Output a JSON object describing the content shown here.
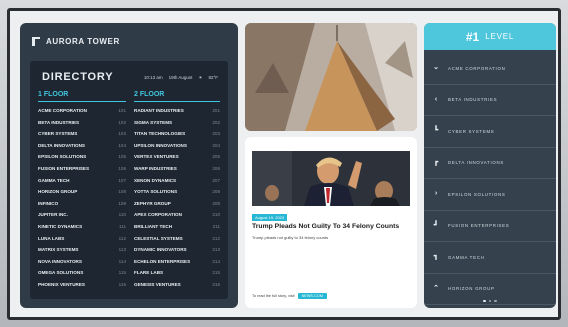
{
  "brand": {
    "name": "AURORA TOWER"
  },
  "directory": {
    "title": "DIRECTORY",
    "time": "10:13 am",
    "date": "19th August",
    "temperature": "82°F",
    "floor1": {
      "heading": "1 FLOOR",
      "items": [
        {
          "name": "ACME CORPORATION",
          "no": "101"
        },
        {
          "name": "BETA INDUSTRIES",
          "no": "102"
        },
        {
          "name": "CYBER SYSTEMS",
          "no": "103"
        },
        {
          "name": "DELTA INNOVATIONS",
          "no": "104"
        },
        {
          "name": "EPSILON SOLUTIONS",
          "no": "105"
        },
        {
          "name": "FUSION ENTERPRISES",
          "no": "106"
        },
        {
          "name": "GAMMA TECH",
          "no": "107"
        },
        {
          "name": "HORIZON GROUP",
          "no": "108"
        },
        {
          "name": "INFINICO",
          "no": "109"
        },
        {
          "name": "JUPITER INC.",
          "no": "110"
        },
        {
          "name": "KINETIC DYNAMICS",
          "no": "111"
        },
        {
          "name": "LUNA LABS",
          "no": "112"
        },
        {
          "name": "MATRIX SYSTEMS",
          "no": "113"
        },
        {
          "name": "NOVA INNOVATORS",
          "no": "114"
        },
        {
          "name": "OMEGA SOLUTIONS",
          "no": "115"
        },
        {
          "name": "PHOENIX VENTURES",
          "no": "116"
        }
      ]
    },
    "floor2": {
      "heading": "2 FLOOR",
      "items": [
        {
          "name": "RADIANT INDUSTRIES",
          "no": "201"
        },
        {
          "name": "SIGMA SYSTEMS",
          "no": "202"
        },
        {
          "name": "TITAN TECHNOLOGIES",
          "no": "203"
        },
        {
          "name": "UPSILON INNOVATIONS",
          "no": "204"
        },
        {
          "name": "VERTEX VENTURES",
          "no": "205"
        },
        {
          "name": "WARP INDUSTRIES",
          "no": "206"
        },
        {
          "name": "XENON DYNAMICS",
          "no": "207"
        },
        {
          "name": "YOTTA SOLUTIONS",
          "no": "208"
        },
        {
          "name": "ZEPHYR GROUP",
          "no": "209"
        },
        {
          "name": "APEX CORPORATION",
          "no": "210"
        },
        {
          "name": "BRILLIANT TECH",
          "no": "211"
        },
        {
          "name": "CELESTIAL SYSTEMS",
          "no": "212"
        },
        {
          "name": "DYNAMIC INNOVATORS",
          "no": "213"
        },
        {
          "name": "ECHELON ENTERPRISES",
          "no": "214"
        },
        {
          "name": "FLARE LABS",
          "no": "215"
        },
        {
          "name": "GENESIS VENTURES",
          "no": "216"
        }
      ]
    }
  },
  "news": {
    "date": "August 19, 2023",
    "title": "Trump Pleads Not Guilty To 34 Felony Counts",
    "subtitle": "Trump pleads not guilty to 34 felony counts",
    "footer_text": "To read the full story, visit",
    "footer_link": "NEWS.COM"
  },
  "level": {
    "number": "#1",
    "word": "LEVEL",
    "tenants": [
      {
        "name": "ACME CORPORATION",
        "arrow": "down"
      },
      {
        "name": "BETA INDUSTRIES",
        "arrow": "left"
      },
      {
        "name": "CYBER SYSTEMS",
        "arrow": "corner-up-right"
      },
      {
        "name": "DELTA INNOVATIONS",
        "arrow": "corner-down-left"
      },
      {
        "name": "EPSILON SOLUTIONS",
        "arrow": "right"
      },
      {
        "name": "FUSION ENTERPRISES",
        "arrow": "corner-up-left"
      },
      {
        "name": "GAMMA TECH",
        "arrow": "corner-down-right"
      },
      {
        "name": "HORIZON GROUP",
        "arrow": "up"
      }
    ]
  },
  "colors": {
    "accent": "#42c5e0",
    "panel": "#2f3b47",
    "level_head": "#4ec6db"
  }
}
